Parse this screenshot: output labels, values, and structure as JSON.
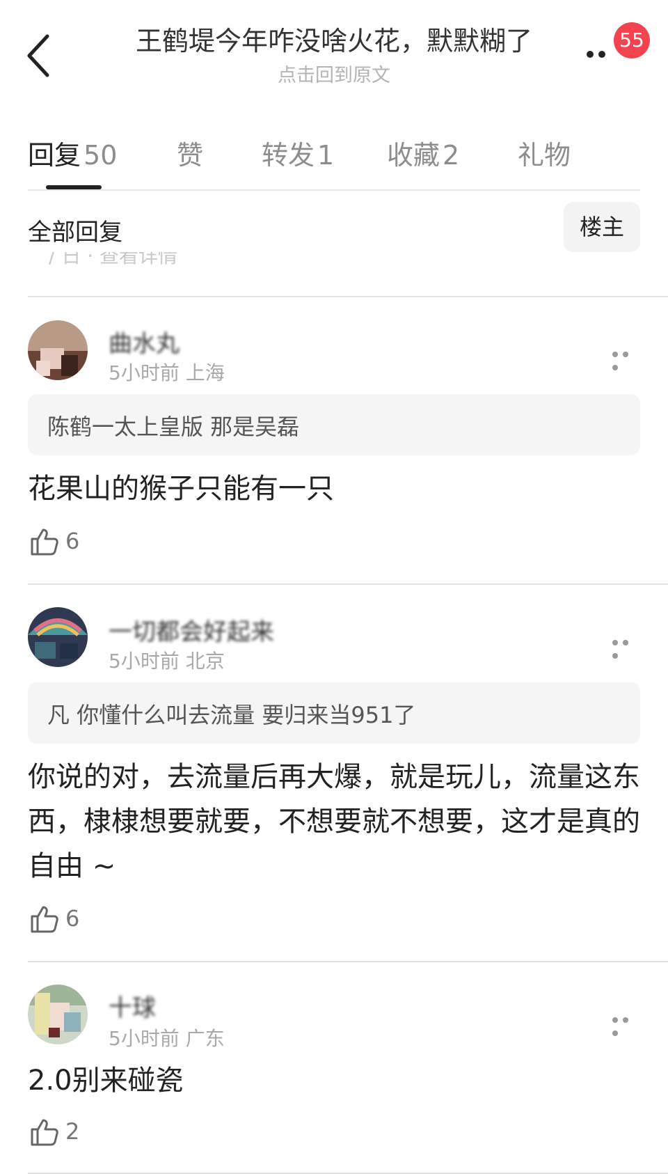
{
  "header": {
    "title": "王鹤堤今年咋没啥火花，默默糊了",
    "subtitle": "点击回到原文",
    "badge_count": "55"
  },
  "tabs": [
    {
      "label": "回复",
      "count": "50",
      "active": true
    },
    {
      "label": "赞",
      "count": "",
      "active": false
    },
    {
      "label": "转发",
      "count": "1",
      "active": false
    },
    {
      "label": "收藏",
      "count": "2",
      "active": false
    },
    {
      "label": "礼物",
      "count": "",
      "active": false
    }
  ],
  "filter": {
    "all_label": "全部回复",
    "op_label": "楼主"
  },
  "ghost_text": "/ 日 · 查看详情",
  "comments": [
    {
      "username": "曲水丸",
      "meta": "5小时前 上海",
      "quote": "陈鹤一太上皇版 那是吴磊",
      "text": "花果山的猴子只能有一只",
      "likes": "6"
    },
    {
      "username": "一切都会好起来",
      "meta": "5小时前 北京",
      "quote": "凡 你懂什么叫去流量 要归来当951了",
      "text": "你说的对，去流量后再大爆，就是玩儿，流量这东西，棣棣想要就要，不想要就不想要，这才是真的自由 ~",
      "likes": "6"
    },
    {
      "username": "十球",
      "meta": "5小时前 广东",
      "quote": "",
      "text": "2.0别来碰瓷",
      "likes": "2"
    }
  ],
  "colors": {
    "badge": "#f2434f",
    "quote_bg": "#f5f5f5",
    "muted": "#a9a9a9"
  }
}
